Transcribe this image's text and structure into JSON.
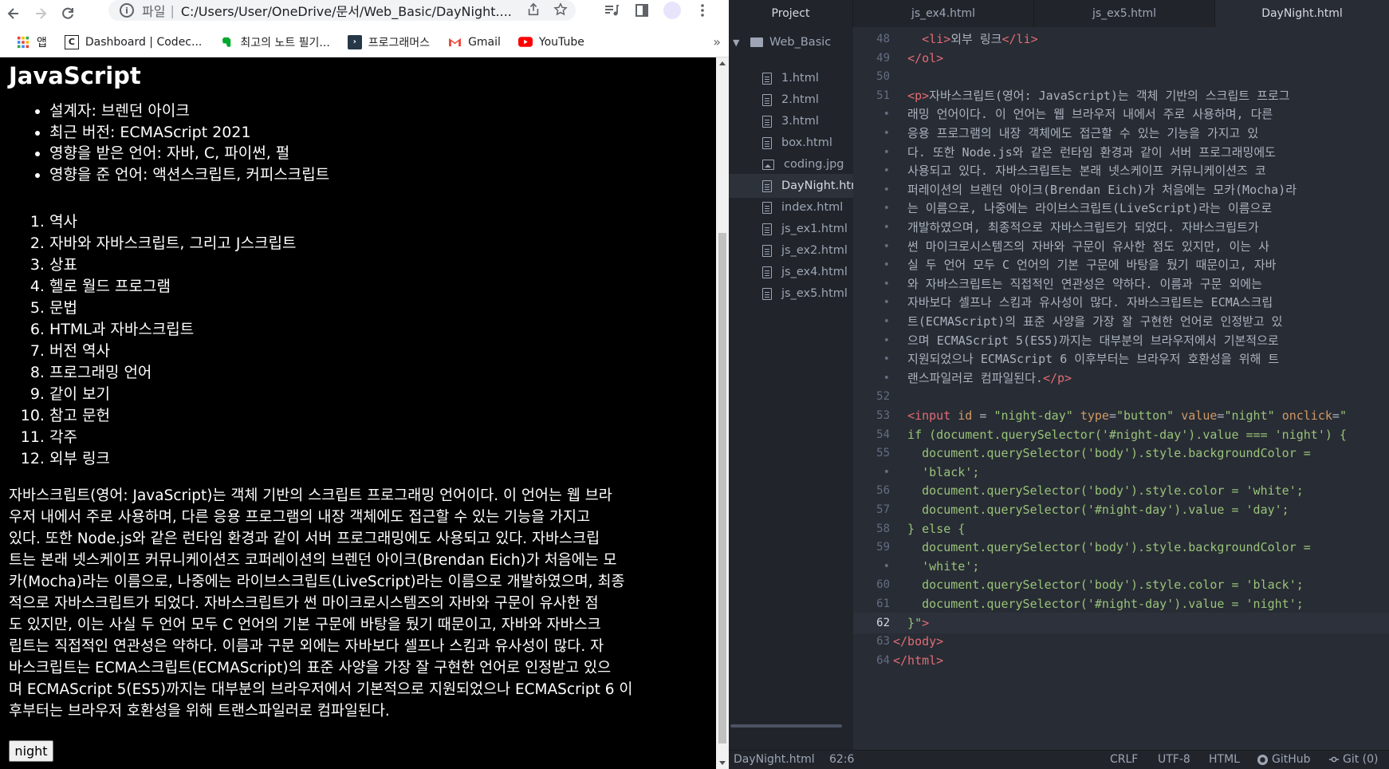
{
  "browser": {
    "address": {
      "scheme": "파일",
      "path": "C:/Users/User/OneDrive/문서/Web_Basic/DayNight...."
    },
    "bookmarks": [
      {
        "label": "앱",
        "icon": "apps-grid-icon",
        "color": "#ea4335"
      },
      {
        "label": "Dashboard | Codec...",
        "icon": "codecademy-icon",
        "color": "#1f1f1f"
      },
      {
        "label": "최고의 노트 필기...",
        "icon": "evernote-icon",
        "color": "#00a82d"
      },
      {
        "label": "프로그래머스",
        "icon": "programmers-icon",
        "color": "#263747"
      },
      {
        "label": "Gmail",
        "icon": "gmail-icon",
        "color": "#ea4335"
      },
      {
        "label": "YouTube",
        "icon": "youtube-icon",
        "color": "#ff0000"
      }
    ],
    "more_bookmarks": "»"
  },
  "page": {
    "title": "JavaScript",
    "info": [
      "설계자: 브렌던 아이크",
      "최근 버전: ECMAScript 2021",
      "영향을 받은 언어: 자바, C, 파이썬, 펄",
      "영향을 준 언어: 액션스크립트, 커피스크립트"
    ],
    "toc": [
      "역사",
      "자바와 자바스크립트, 그리고 J스크립트",
      "상표",
      "헬로 월드 프로그램",
      "문법",
      "HTML과 자바스크립트",
      "버전 역사",
      "프로그래밍 언어",
      "같이 보기",
      "참고 문헌",
      "각주",
      "외부 링크"
    ],
    "description_lines": [
      "자바스크립트(영어: JavaScript)는 객체 기반의 스크립트 프로그래밍 언어이다. 이 언어는 웹 브라",
      "우저 내에서 주로 사용하며, 다른 응용 프로그램의 내장 객체에도 접근할 수 있는 기능을 가지고",
      "있다. 또한 Node.js와 같은 런타임 환경과 같이 서버 프로그래밍에도 사용되고 있다. 자바스크립",
      "트는 본래 넷스케이프 커뮤니케이션즈 코퍼레이션의 브렌던 아이크(Brendan Eich)가 처음에는 모",
      "카(Mocha)라는 이름으로, 나중에는 라이브스크립트(LiveScript)라는 이름으로 개발하였으며, 최종",
      "적으로 자바스크립트가 되었다. 자바스크립트가 썬 마이크로시스템즈의 자바와 구문이 유사한 점",
      "도 있지만, 이는 사실 두 언어 모두 C 언어의 기본 구문에 바탕을 뒀기 때문이고, 자바와 자바스크",
      "립트는 직접적인 연관성은 약하다. 이름과 구문 외에는 자바보다 셀프나 스킴과 유사성이 많다. 자",
      "바스크립트는 ECMA스크립트(ECMAScript)의 표준 사양을 가장 잘 구현한 언어로 인정받고 있으",
      "며 ECMAScript 5(ES5)까지는 대부분의 브라우저에서 기본적으로 지원되었으나 ECMAScript 6 이",
      "후부터는 브라우저 호환성을 위해 트랜스파일러로 컴파일된다."
    ],
    "button_value": "night",
    "background": "#000000",
    "text_color": "#ffffff"
  },
  "editor": {
    "tabs": {
      "project": "Project",
      "files": [
        "js_ex4.html",
        "js_ex5.html",
        "DayNight.html"
      ],
      "active": "DayNight.html"
    },
    "tree": {
      "root": "Web_Basic",
      "items": [
        {
          "name": "1.html",
          "type": "file"
        },
        {
          "name": "2.html",
          "type": "file"
        },
        {
          "name": "3.html",
          "type": "file"
        },
        {
          "name": "box.html",
          "type": "file"
        },
        {
          "name": "coding.jpg",
          "type": "image"
        },
        {
          "name": "DayNight.htm",
          "type": "file",
          "selected": true
        },
        {
          "name": "index.html",
          "type": "file"
        },
        {
          "name": "js_ex1.html",
          "type": "file"
        },
        {
          "name": "js_ex2.html",
          "type": "file"
        },
        {
          "name": "js_ex4.html",
          "type": "file"
        },
        {
          "name": "js_ex5.html",
          "type": "file"
        }
      ]
    },
    "code_lines": [
      {
        "n": "48",
        "segs": [
          [
            "pl",
            "    "
          ],
          [
            "tag",
            "<li>"
          ],
          [
            "pl",
            "외부 링크"
          ],
          [
            "tag",
            "</li>"
          ]
        ]
      },
      {
        "n": "49",
        "segs": [
          [
            "pl",
            "  "
          ],
          [
            "tag",
            "</ol>"
          ]
        ]
      },
      {
        "n": "50",
        "segs": []
      },
      {
        "n": "51",
        "segs": [
          [
            "pl",
            "  "
          ],
          [
            "tag",
            "<p>"
          ],
          [
            "pl",
            "자바스크립트(영어: JavaScript)는 객체 기반의 스크립트 프로그"
          ]
        ]
      },
      {
        "n": "•",
        "segs": [
          [
            "pl",
            "  래밍 언어이다. 이 언어는 웹 브라우저 내에서 주로 사용하며, 다른"
          ]
        ]
      },
      {
        "n": "•",
        "segs": [
          [
            "pl",
            "  응용 프로그램의 내장 객체에도 접근할 수 있는 기능을 가지고 있"
          ]
        ]
      },
      {
        "n": "•",
        "segs": [
          [
            "pl",
            "  다. 또한 Node.js와 같은 런타임 환경과 같이 서버 프로그래밍에도"
          ]
        ]
      },
      {
        "n": "•",
        "segs": [
          [
            "pl",
            "  사용되고 있다. 자바스크립트는 본래 넷스케이프 커뮤니케이션즈 코"
          ]
        ]
      },
      {
        "n": "•",
        "segs": [
          [
            "pl",
            "  퍼레이션의 브렌던 아이크(Brendan Eich)가 처음에는 모카(Mocha)라"
          ]
        ]
      },
      {
        "n": "•",
        "segs": [
          [
            "pl",
            "  는 이름으로, 나중에는 라이브스크립트(LiveScript)라는 이름으로"
          ]
        ]
      },
      {
        "n": "•",
        "segs": [
          [
            "pl",
            "  개발하였으며, 최종적으로 자바스크립트가 되었다. 자바스크립트가"
          ]
        ]
      },
      {
        "n": "•",
        "segs": [
          [
            "pl",
            "  썬 마이크로시스템즈의 자바와 구문이 유사한 점도 있지만, 이는 사"
          ]
        ]
      },
      {
        "n": "•",
        "segs": [
          [
            "pl",
            "  실 두 언어 모두 C 언어의 기본 구문에 바탕을 뒀기 때문이고, 자바"
          ]
        ]
      },
      {
        "n": "•",
        "segs": [
          [
            "pl",
            "  와 자바스크립트는 직접적인 연관성은 약하다. 이름과 구문 외에는"
          ]
        ]
      },
      {
        "n": "•",
        "segs": [
          [
            "pl",
            "  자바보다 셀프나 스킴과 유사성이 많다. 자바스크립트는 ECMA스크립"
          ]
        ]
      },
      {
        "n": "•",
        "segs": [
          [
            "pl",
            "  트(ECMAScript)의 표준 사양을 가장 잘 구현한 언어로 인정받고 있"
          ]
        ]
      },
      {
        "n": "•",
        "segs": [
          [
            "pl",
            "  으며 ECMAScript 5(ES5)까지는 대부분의 브라우저에서 기본적으로"
          ]
        ]
      },
      {
        "n": "•",
        "segs": [
          [
            "pl",
            "  지원되었으나 ECMAScript 6 이후부터는 브라우저 호환성을 위해 트"
          ]
        ]
      },
      {
        "n": "•",
        "segs": [
          [
            "pl",
            "  랜스파일러로 컴파일된다."
          ],
          [
            "tag",
            "</p>"
          ]
        ]
      },
      {
        "n": "52",
        "segs": []
      },
      {
        "n": "53",
        "segs": [
          [
            "pl",
            "  "
          ],
          [
            "tag",
            "<input "
          ],
          [
            "attr",
            "id"
          ],
          [
            "pl",
            " = "
          ],
          [
            "str",
            "\"night-day\""
          ],
          [
            "pl",
            " "
          ],
          [
            "attr",
            "type"
          ],
          [
            "pl",
            "="
          ],
          [
            "str",
            "\"button\""
          ],
          [
            "pl",
            " "
          ],
          [
            "attr",
            "value"
          ],
          [
            "pl",
            "="
          ],
          [
            "str",
            "\"night\""
          ],
          [
            "pl",
            " "
          ],
          [
            "attr",
            "onclick"
          ],
          [
            "pl",
            "="
          ],
          [
            "str",
            "\""
          ]
        ]
      },
      {
        "n": "54",
        "segs": [
          [
            "str",
            "  if (document.querySelector('#night-day').value === 'night') {"
          ]
        ]
      },
      {
        "n": "55",
        "segs": [
          [
            "str",
            "    document.querySelector('body').style.backgroundColor ="
          ]
        ]
      },
      {
        "n": "•",
        "segs": [
          [
            "str",
            "    'black';"
          ]
        ]
      },
      {
        "n": "56",
        "segs": [
          [
            "str",
            "    document.querySelector('body').style.color = 'white';"
          ]
        ]
      },
      {
        "n": "57",
        "segs": [
          [
            "str",
            "    document.querySelector('#night-day').value = 'day';"
          ]
        ]
      },
      {
        "n": "58",
        "segs": [
          [
            "str",
            "  } else {"
          ]
        ]
      },
      {
        "n": "59",
        "segs": [
          [
            "str",
            "    document.querySelector('body').style.backgroundColor ="
          ]
        ]
      },
      {
        "n": "•",
        "segs": [
          [
            "str",
            "    'white';"
          ]
        ]
      },
      {
        "n": "60",
        "segs": [
          [
            "str",
            "    document.querySelector('body').style.color = 'black';"
          ]
        ]
      },
      {
        "n": "61",
        "segs": [
          [
            "str",
            "    document.querySelector('#night-day').value = 'night';"
          ]
        ]
      },
      {
        "n": "62",
        "segs": [
          [
            "str",
            "  }\""
          ],
          [
            "tag",
            ">"
          ]
        ],
        "current": true
      },
      {
        "n": "63",
        "segs": [
          [
            "tag",
            "</body>"
          ]
        ]
      },
      {
        "n": "64",
        "segs": [
          [
            "tag",
            "</html>"
          ]
        ]
      }
    ],
    "status": {
      "file": "DayNight.html",
      "cursor": "62:6",
      "line_ending": "CRLF",
      "encoding": "UTF-8",
      "grammar": "HTML",
      "github": "GitHub",
      "git": "Git (0)"
    }
  }
}
